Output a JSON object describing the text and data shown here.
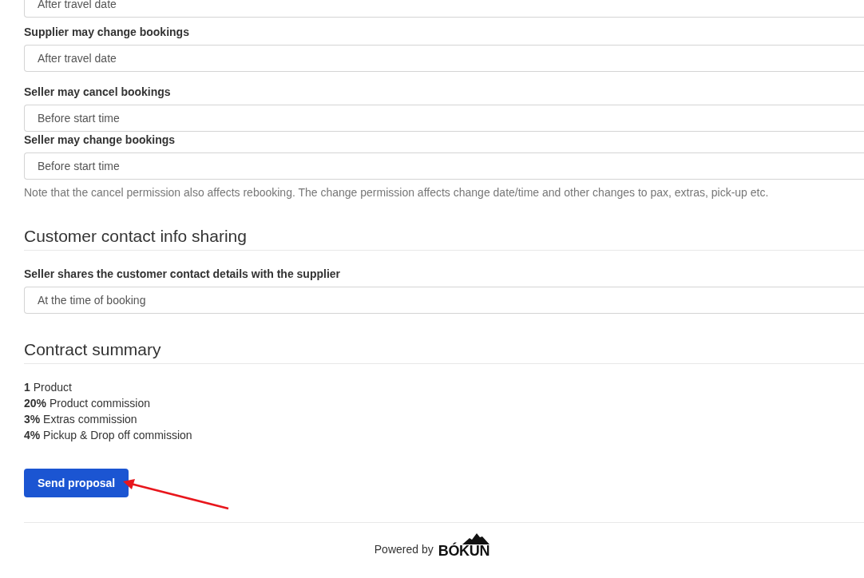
{
  "booking_permissions": {
    "fields": [
      {
        "value": "After travel date"
      },
      {
        "label": "Supplier may change bookings",
        "value": "After travel date"
      },
      {
        "label": "Seller may cancel bookings",
        "value": "Before start time"
      },
      {
        "label": "Seller may change bookings",
        "value": "Before start time"
      }
    ],
    "note": "Note that the cancel permission also affects rebooking. The change permission affects change date/time and other changes to pax, extras, pick-up etc."
  },
  "contact_sharing": {
    "title": "Customer contact info sharing",
    "fields": [
      {
        "label": "Seller shares the customer contact details with the supplier",
        "value": "At the time of booking"
      }
    ]
  },
  "contract_summary": {
    "title": "Contract summary",
    "lines": [
      "**1** Product",
      "**20%** Product commission",
      "**3%** Extras commission",
      "**4%** Pickup & Drop off commission"
    ]
  },
  "submit_button": "Send proposal",
  "footer": {
    "powered_by": "Powered by",
    "logo": "BÓKUN"
  }
}
